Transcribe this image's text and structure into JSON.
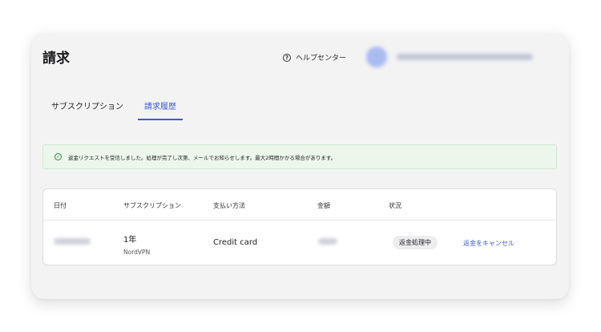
{
  "header": {
    "title": "請求",
    "help_label": "ヘルプセンター"
  },
  "tabs": [
    {
      "label": "サブスクリプション",
      "active": false
    },
    {
      "label": "請求履歴",
      "active": true
    }
  ],
  "alert": {
    "message": "返金リクエストを受信しました。処理が完了し次第、メールでお知らせします。最大2時間かかる場合があります。"
  },
  "table": {
    "columns": [
      "日付",
      "サブスクリプション",
      "支払い方法",
      "金額",
      "状況"
    ],
    "rows": [
      {
        "plan": "1年",
        "product": "NordVPN",
        "payment_method": "Credit card",
        "status": "返金処理中",
        "action": "返金をキャンセル"
      }
    ]
  },
  "colors": {
    "accent": "#3b5bdb",
    "alert_bg": "#eaf7ea",
    "success": "#2e8b3d"
  }
}
